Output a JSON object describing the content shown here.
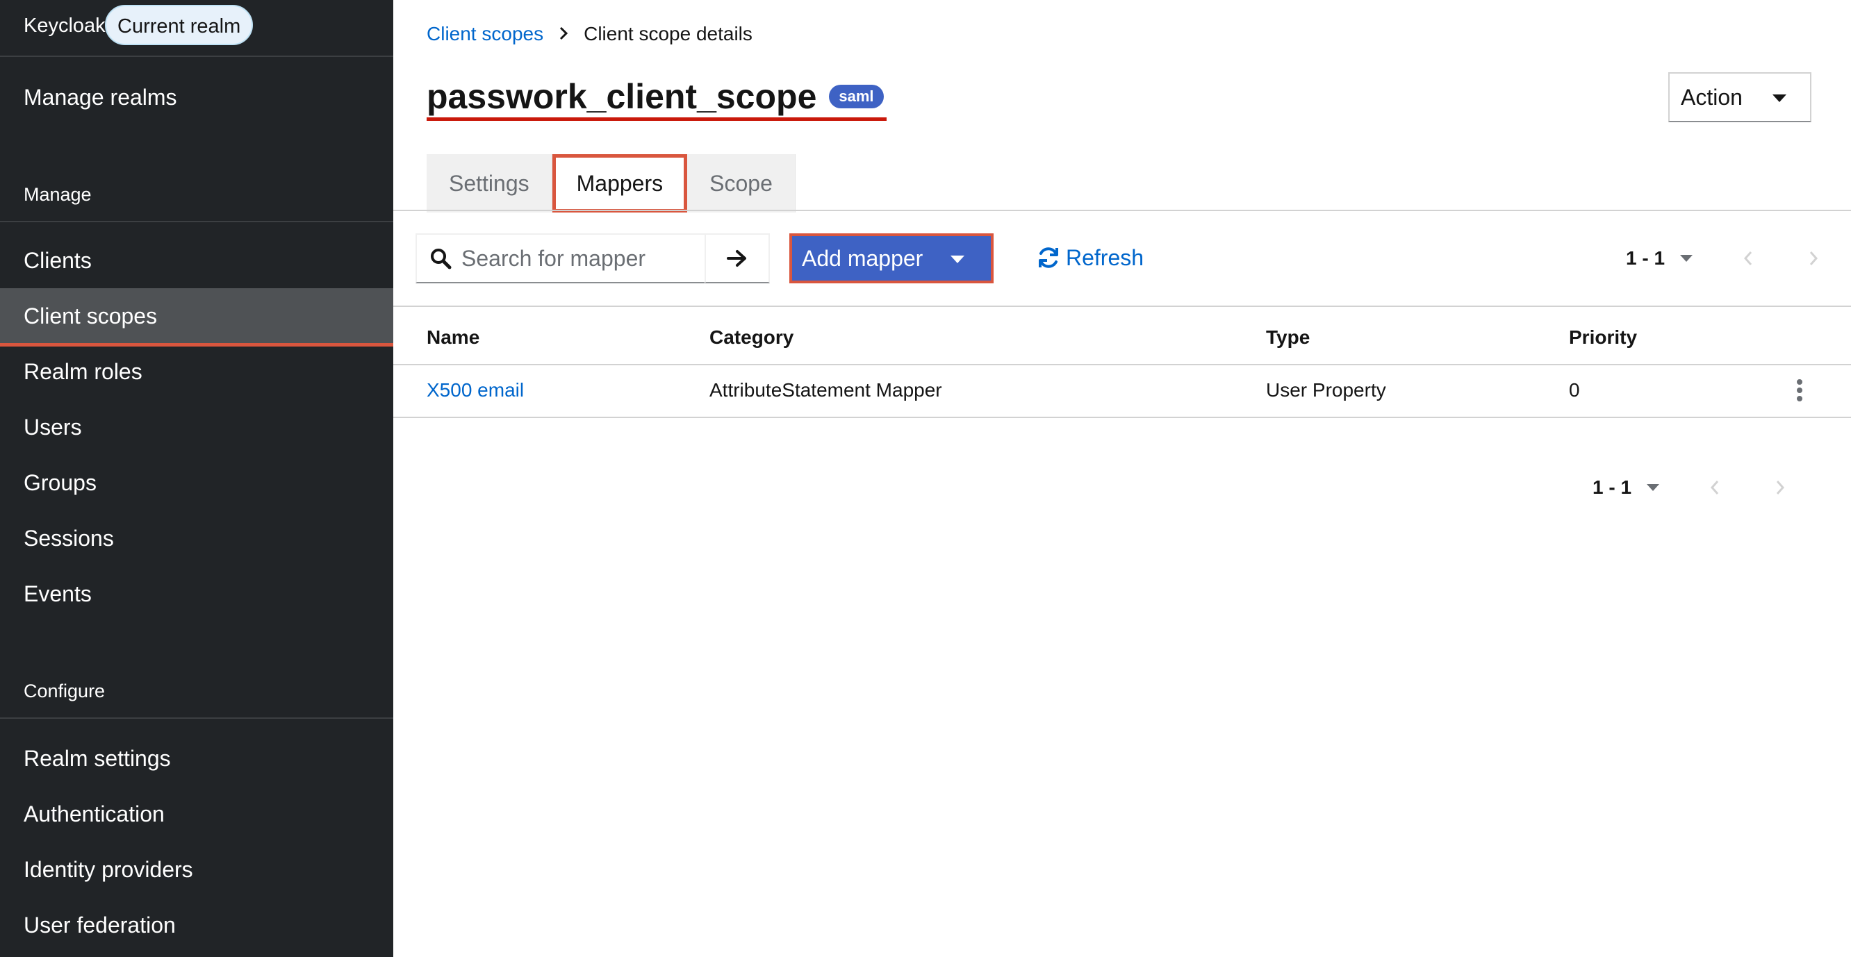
{
  "sidebar": {
    "brand": "Keycloak",
    "realm_pill": "Current realm",
    "manage_realms": "Manage realms",
    "manage_section": "Manage",
    "manage_items": [
      {
        "label": "Clients"
      },
      {
        "label": "Client scopes",
        "active": true
      },
      {
        "label": "Realm roles"
      },
      {
        "label": "Users"
      },
      {
        "label": "Groups"
      },
      {
        "label": "Sessions"
      },
      {
        "label": "Events"
      }
    ],
    "configure_section": "Configure",
    "configure_items": [
      {
        "label": "Realm settings"
      },
      {
        "label": "Authentication"
      },
      {
        "label": "Identity providers"
      },
      {
        "label": "User federation"
      }
    ]
  },
  "breadcrumb": {
    "parent": "Client scopes",
    "current": "Client scope details"
  },
  "header": {
    "title": "passwork_client_scope",
    "protocol_badge": "saml",
    "action_label": "Action"
  },
  "tabs": [
    {
      "label": "Settings"
    },
    {
      "label": "Mappers",
      "active": true
    },
    {
      "label": "Scope"
    }
  ],
  "toolbar": {
    "search_placeholder": "Search for mapper",
    "add_mapper_label": "Add mapper",
    "refresh_label": "Refresh",
    "pagination_range": "1 - 1"
  },
  "table": {
    "columns": [
      "Name",
      "Category",
      "Type",
      "Priority"
    ],
    "rows": [
      {
        "name": "X500 email",
        "category": "AttributeStatement Mapper",
        "type": "User Property",
        "priority": "0"
      }
    ]
  },
  "footer_pagination": {
    "range": "1 - 1"
  },
  "colors": {
    "sidebar_bg": "#212427",
    "sidebar_active": "#4f5255",
    "primary": "#3e62c4",
    "link": "#0066cc",
    "highlight": "#d9563e"
  }
}
